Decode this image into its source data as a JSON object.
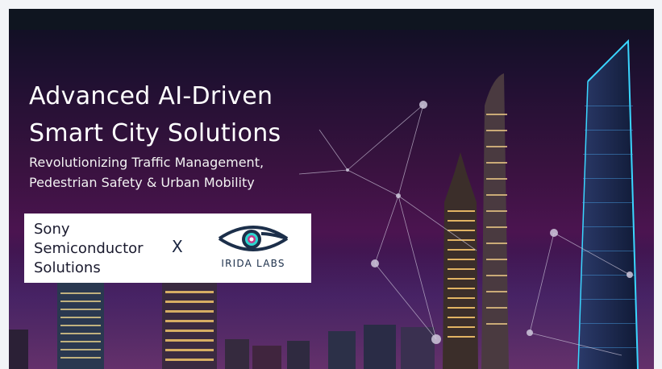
{
  "banner": {
    "title_lines": [
      "Advanced AI-Driven",
      "Smart City Solutions"
    ],
    "subtitle_lines": [
      "Revolutionizing Traffic Management,",
      "Pedestrian Safety & Urban Mobility"
    ]
  },
  "partners": {
    "sony_lines": [
      "Sony",
      "Semiconductor",
      "Solutions"
    ],
    "separator": "X",
    "irida_name": "IRIDA LABS"
  },
  "colors": {
    "title": "#ffffff",
    "logo_box": "#ffffff",
    "sony_text": "#1a1a2e",
    "irida_blue": "#1c2f4a",
    "irida_eye": "#2fd6d0",
    "accent_magenta": "#c2388a"
  },
  "icons": {
    "irida": "irida-eye-logo-icon",
    "network": "network-lines-icon"
  }
}
